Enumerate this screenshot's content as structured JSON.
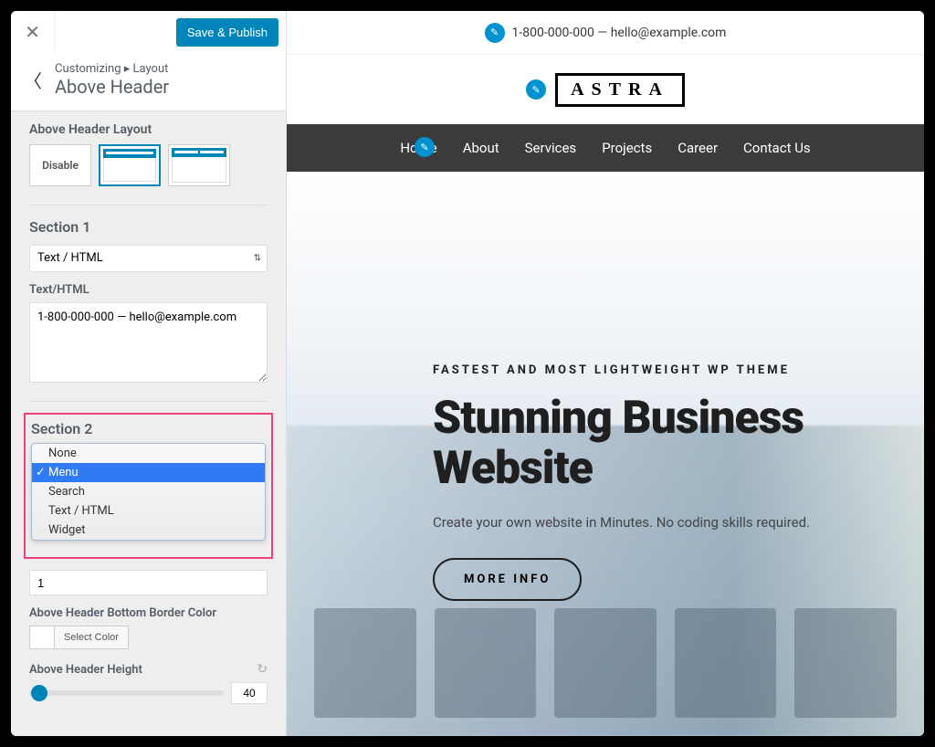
{
  "sidebar": {
    "save_label": "Save & Publish",
    "crumb_prefix": "Customizing ▸ Layout",
    "crumb_title": "Above Header",
    "layout_label": "Above Header Layout",
    "disable_label": "Disable",
    "section1_title": "Section 1",
    "section1_select": "Text / HTML",
    "texthtml_label": "Text/HTML",
    "texthtml_value": "1-800-000-000 — hello@example.com",
    "section2_title": "Section 2",
    "section2_options": [
      "None",
      "Menu",
      "Search",
      "Text / HTML",
      "Widget"
    ],
    "section2_selected": "Menu",
    "border_size_value": "1",
    "border_color_label": "Above Header Bottom Border Color",
    "select_color": "Select Color",
    "height_label": "Above Header Height",
    "height_value": "40"
  },
  "preview": {
    "topbar_text": "1-800-000-000 — hello@example.com",
    "logo_text": "ASTRA",
    "nav": [
      "Home",
      "About",
      "Services",
      "Projects",
      "Career",
      "Contact Us"
    ],
    "hero_tag": "FASTEST AND MOST LIGHTWEIGHT WP THEME",
    "hero_title": "Stunning Business Website",
    "hero_sub": "Create your own website in Minutes. No coding skills required.",
    "hero_btn": "MORE INFO"
  }
}
